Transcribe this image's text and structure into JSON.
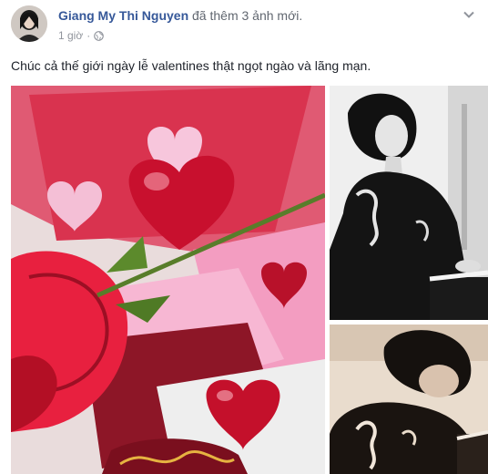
{
  "post": {
    "author": "Giang My Thi Nguyen",
    "action": "đã thêm 3 ảnh mới.",
    "time": "1 giờ",
    "separator": "·",
    "privacy_icon": "globe-icon",
    "more_icon": "chevron-down-icon",
    "text": "Chúc cả thế giới ngày lễ valentines thật ngọt ngào và lãng mạn."
  },
  "photos": [
    {
      "icon": "valentine-hearts-rose-photo",
      "colors": [
        "#e0294a",
        "#f2a6c4",
        "#c91a2e"
      ]
    },
    {
      "icon": "woman-at-piano-bw-photo",
      "colors": [
        "#111111",
        "#f1f1f1"
      ]
    },
    {
      "icon": "woman-at-piano-sepia-photo",
      "colors": [
        "#1a1512",
        "#e8d9c9"
      ]
    }
  ]
}
